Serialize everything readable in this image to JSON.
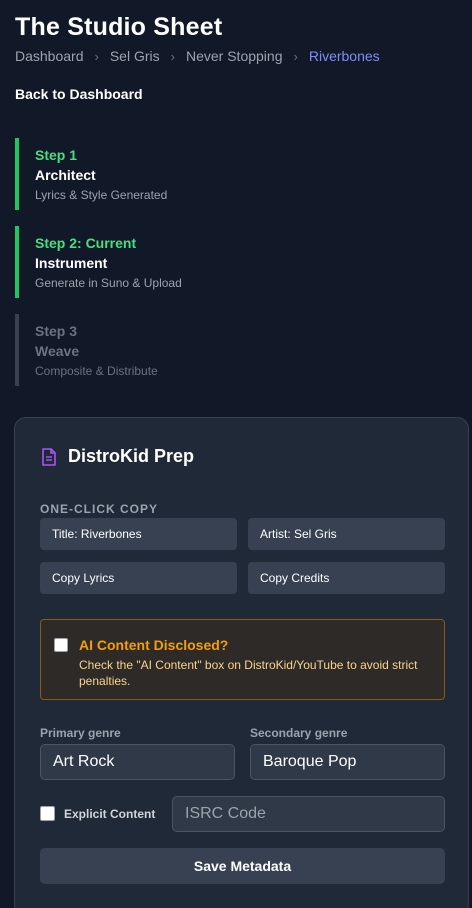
{
  "app_title": "The Studio Sheet",
  "breadcrumb": {
    "items": [
      "Dashboard",
      "Sel Gris",
      "Never Stopping"
    ],
    "current": "Riverbones",
    "separator": "›"
  },
  "back_link": "Back to Dashboard",
  "steps": [
    {
      "num": "Step 1",
      "name": "Architect",
      "desc": "Lyrics & Style Generated",
      "status": "complete"
    },
    {
      "num": "Step 2: Current",
      "name": "Instrument",
      "desc": "Generate in Suno & Upload",
      "status": "current"
    },
    {
      "num": "Step 3",
      "name": "Weave",
      "desc": "Composite & Distribute",
      "status": "pending"
    }
  ],
  "card": {
    "title": "DistroKid Prep",
    "icon": "document-icon",
    "copy_section_label": "ONE-CLICK COPY",
    "copy_buttons": {
      "title": "Title: Riverbones",
      "artist": "Artist: Sel Gris",
      "lyrics": "Copy Lyrics",
      "credits": "Copy Credits"
    },
    "ai_disclosure": {
      "title": "AI Content Disclosed?",
      "desc": "Check the \"AI Content\" box on DistroKid/YouTube to avoid strict penalties.",
      "checked": false
    },
    "primary_genre": {
      "label": "Primary genre",
      "value": "Art Rock"
    },
    "secondary_genre": {
      "label": "Secondary genre",
      "value": "Baroque Pop"
    },
    "explicit": {
      "label": "Explicit Content",
      "checked": false
    },
    "isrc": {
      "placeholder": "ISRC Code",
      "value": ""
    },
    "save_label": "Save Metadata"
  },
  "colors": {
    "background": "#111827",
    "card": "#1f2937",
    "step_complete": "#22c55e",
    "breadcrumb_current": "#818cf8",
    "warning": "#f59e0b",
    "icon_accent": "#a855f7"
  }
}
